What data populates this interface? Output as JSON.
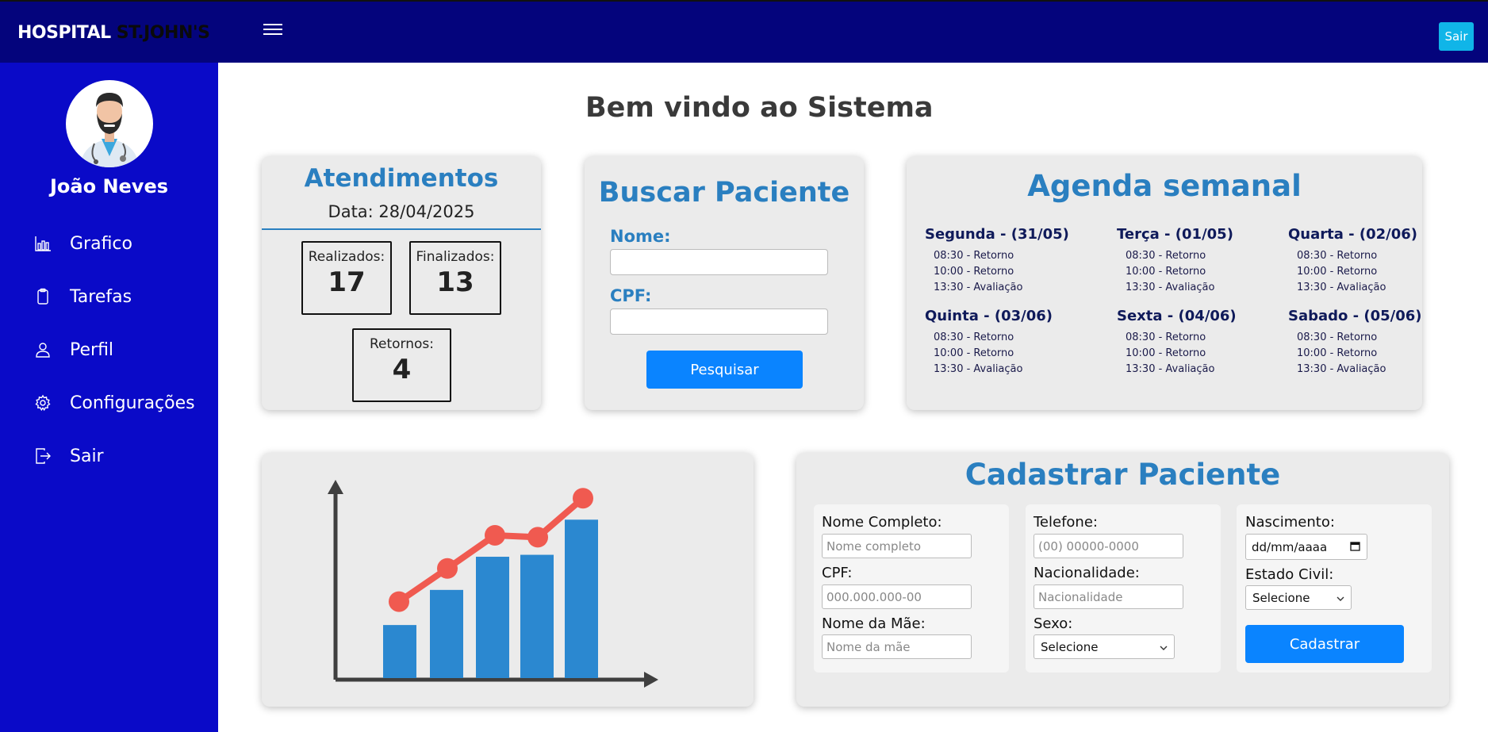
{
  "header": {
    "logo_part1": "HOSPITAL",
    "logo_part2": "ST.JOHN'S",
    "logout_label": "Sair"
  },
  "sidebar": {
    "user_name": "João Neves",
    "items": [
      {
        "label": "Grafico",
        "icon": "bar-chart-icon"
      },
      {
        "label": "Tarefas",
        "icon": "clipboard-icon"
      },
      {
        "label": "Perfil",
        "icon": "user-icon"
      },
      {
        "label": "Configurações",
        "icon": "gear-icon"
      },
      {
        "label": "Sair",
        "icon": "logout-icon"
      }
    ]
  },
  "main": {
    "welcome": "Bem vindo ao Sistema"
  },
  "atendimentos": {
    "title": "Atendimentos",
    "date": "Data: 28/04/2025",
    "realizados_label": "Realizados:",
    "realizados_value": "17",
    "finalizados_label": "Finalizados:",
    "finalizados_value": "13",
    "retornos_label": "Retornos:",
    "retornos_value": "4"
  },
  "buscar": {
    "title": "Buscar Paciente",
    "nome_label": "Nome:",
    "cpf_label": "CPF:",
    "button": "Pesquisar"
  },
  "agenda": {
    "title": "Agenda semanal",
    "days": [
      {
        "title": "Segunda - (31/05)",
        "items": [
          "08:30 - Retorno",
          "10:00 - Retorno",
          "13:30 - Avaliação"
        ]
      },
      {
        "title": "Terça - (01/05)",
        "items": [
          "08:30 - Retorno",
          "10:00 - Retorno",
          "13:30 - Avaliação"
        ]
      },
      {
        "title": "Quarta - (02/06)",
        "items": [
          "08:30 - Retorno",
          "10:00 - Retorno",
          "13:30 - Avaliação"
        ]
      },
      {
        "title": "Quinta - (03/06)",
        "items": [
          "08:30 - Retorno",
          "10:00 - Retorno",
          "13:30 - Avaliação"
        ]
      },
      {
        "title": "Sexta - (04/06)",
        "items": [
          "08:30 - Retorno",
          "10:00 - Retorno",
          "13:30 - Avaliação"
        ]
      },
      {
        "title": "Sabado - (05/06)",
        "items": [
          "08:30 - Retorno",
          "10:00 - Retorno",
          "13:30 - Avaliação"
        ]
      }
    ]
  },
  "illustration": {
    "bar_color": "#2b88d0",
    "line_color": "#f05a50",
    "axis_color": "#3f3f3f",
    "bar_values": [
      28,
      46,
      63,
      64,
      82
    ],
    "line_values": [
      40,
      57,
      74,
      73,
      93
    ]
  },
  "cadastrar": {
    "title": "Cadastrar Paciente",
    "nome_completo_label": "Nome Completo:",
    "nome_completo_placeholder": "Nome completo",
    "cpf_label": "CPF:",
    "cpf_placeholder": "000.000.000-00",
    "nome_mae_label": "Nome da Mãe:",
    "nome_mae_placeholder": "Nome da mãe",
    "telefone_label": "Telefone:",
    "telefone_placeholder": "(00) 00000-0000",
    "nacionalidade_label": "Nacionalidade:",
    "nacionalidade_placeholder": "Nacionalidade",
    "sexo_label": "Sexo:",
    "sexo_value": "Selecione",
    "nascimento_label": "Nascimento:",
    "nascimento_value": "dd/mm/aaaa",
    "estado_civil_label": "Estado Civil:",
    "estado_civil_value": "Selecione",
    "button": "Cadastrar"
  },
  "colors": {
    "topbar": "#04047c",
    "sidebar": "#0a0ac8",
    "accent_title": "#2a7fc0",
    "button": "#0a84ff",
    "logout_button": "#10b5e8"
  }
}
